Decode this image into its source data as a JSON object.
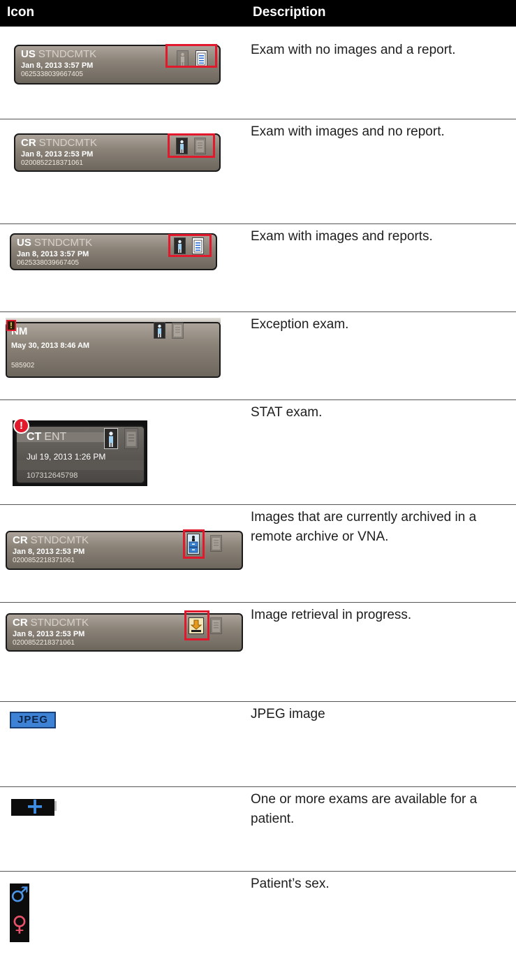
{
  "header": {
    "icon_col": "Icon",
    "desc_col": "Description"
  },
  "rows": [
    {
      "modality": "US",
      "procedure": "STNDCMTK",
      "date": "Jan 8, 2013 3:57 PM",
      "accession": "0625338039667405",
      "description": "Exam with no images and a report."
    },
    {
      "modality": "CR",
      "procedure": "STNDCMTK",
      "date": "Jan 8, 2013 2:53 PM",
      "accession": "0200852218371061",
      "description": "Exam with images and no report."
    },
    {
      "modality": "US",
      "procedure": "STNDCMTK",
      "date": "Jan 8, 2013 3:57 PM",
      "accession": "0625338039667405",
      "description": " Exam with images and reports."
    },
    {
      "modality": "NM",
      "procedure": "",
      "date": "May 30, 2013 8:46 AM",
      "accession": "585902",
      "badge": "!",
      "description": "Exception exam."
    },
    {
      "modality": "CT",
      "procedure": "ENT",
      "date": "Jul 19, 2013 1:26 PM",
      "accession": "107312645798",
      "badge": "!",
      "description": "STAT exam."
    },
    {
      "modality": "CR",
      "procedure": "STNDCMTK",
      "date": "Jan 8, 2013 2:53 PM",
      "accession": "0200852218371061",
      "description": "Images that are currently archived in a remote archive or VNA."
    },
    {
      "modality": "CR",
      "procedure": "STNDCMTK",
      "date": "Jan 8, 2013 2:53 PM",
      "accession": "0200852218371061",
      "description": "Image retrieval in progress."
    },
    {
      "icon_label": "JPEG",
      "description": "JPEG image"
    },
    {
      "icon_label": "+",
      "description": "One or more exams are available for a patient."
    },
    {
      "icon_male": "♂",
      "icon_female": "♀",
      "description": "Patient’s sex."
    }
  ]
}
